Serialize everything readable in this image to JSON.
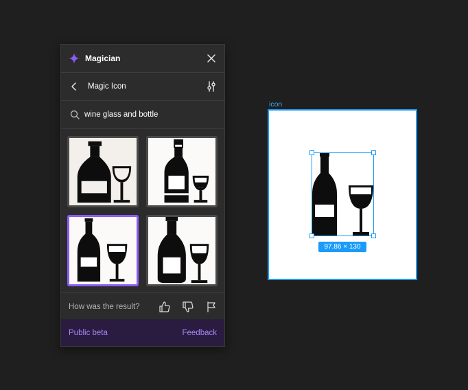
{
  "plugin": {
    "title": "Magician",
    "nav_title": "Magic Icon",
    "search": {
      "value": "wine glass and bottle",
      "placeholder": ""
    },
    "results": [
      {
        "label": "wine bottle and glass result 1",
        "selected": false
      },
      {
        "label": "wine bottle and glass result 2",
        "selected": false
      },
      {
        "label": "wine bottle and glass result 3",
        "selected": true
      },
      {
        "label": "wine bottle and glass result 4",
        "selected": false
      }
    ],
    "feedback_question": "How was the result?",
    "footer": {
      "beta_label": "Public beta",
      "feedback_label": "Feedback"
    },
    "icons": {
      "sparkle": "sparkle-icon",
      "close": "close-icon",
      "back": "chevron-left-icon",
      "settings": "sliders-icon",
      "search": "search-icon",
      "thumbs_up": "thumbs-up-icon",
      "thumbs_down": "thumbs-down-icon",
      "flag": "flag-icon"
    }
  },
  "canvas": {
    "frame_label": "icon",
    "dimensions": "97.86 × 130"
  },
  "colors": {
    "accent": "#8b5cf6",
    "selection": "#1a9bfa",
    "background": "#1f1f1f",
    "panel": "#2c2c2c",
    "footer": "#2a1c40"
  }
}
